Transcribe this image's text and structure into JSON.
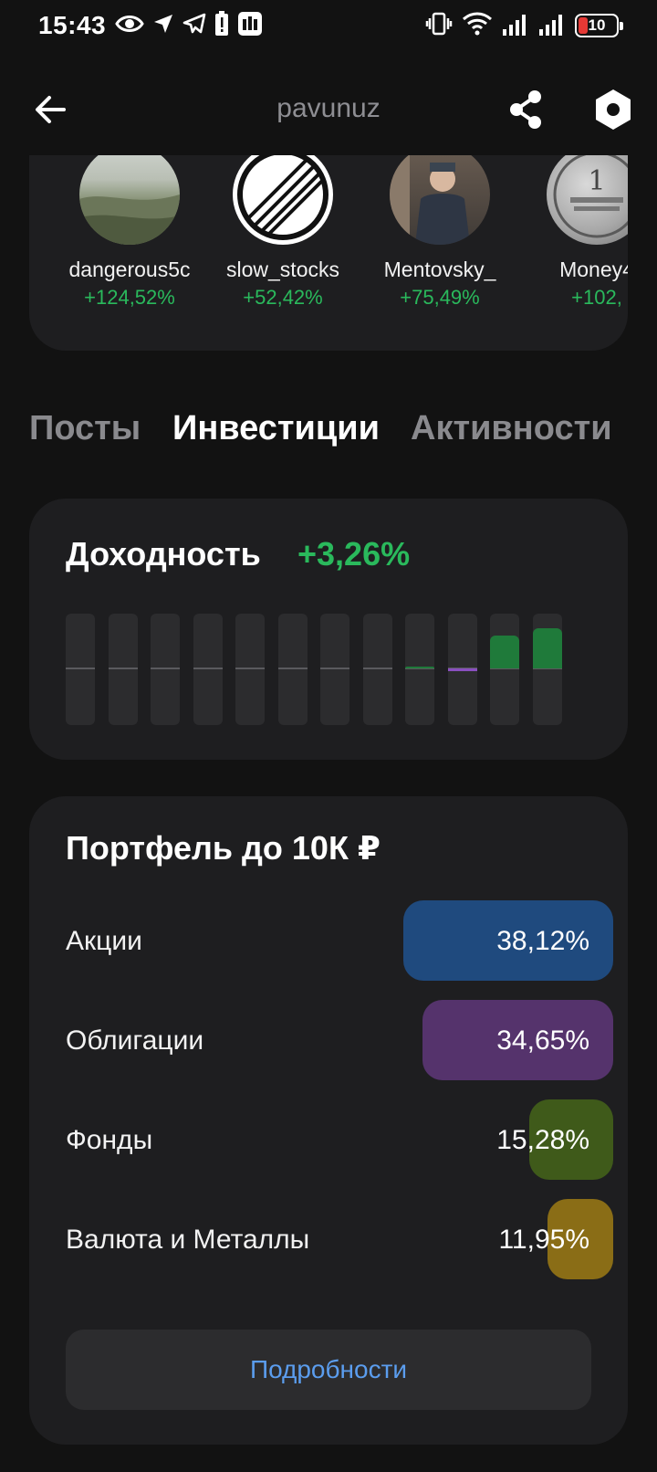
{
  "status_bar": {
    "time": "15:43",
    "battery": "10",
    "battery_color": "#e53935",
    "left_icons": [
      "eye-icon",
      "location-arrow-icon",
      "telegram-icon",
      "alert-battery-icon",
      "app-notification-icon"
    ],
    "right_icons": [
      "vibrate-icon",
      "wifi-icon",
      "signal-icon",
      "signal-icon-2",
      "battery-icon"
    ]
  },
  "app_bar": {
    "title": "pavunuz",
    "icons": [
      "back-arrow-icon",
      "share-icon",
      "hexagon-settings-icon"
    ]
  },
  "people": [
    {
      "name": "dangerous5с",
      "change": "+124,52%"
    },
    {
      "name": "slow_stocks",
      "change": "+52,42%"
    },
    {
      "name": "Mentovsky_",
      "change": "+75,49%"
    },
    {
      "name": "Money4",
      "change": "+102,"
    }
  ],
  "tabs": [
    {
      "label": "Посты",
      "active": false
    },
    {
      "label": "Инвестиции",
      "active": true
    },
    {
      "label": "Активности",
      "active": false
    }
  ],
  "yield": {
    "title": "Доходность",
    "value": "+3,26%",
    "value_color": "#2ab95c",
    "monthly_bars": [
      0,
      0,
      0,
      0,
      0,
      0,
      0,
      0,
      0.3,
      -0.8,
      9,
      11
    ],
    "bar_scale_max": 12
  },
  "portfolio": {
    "title": "Портфель до 10К ₽",
    "rows": [
      {
        "label": "Акции",
        "value": "38,12%",
        "share": 38.12,
        "color": "#1f4a7e"
      },
      {
        "label": "Облигации",
        "value": "34,65%",
        "share": 34.65,
        "color": "#55336c"
      },
      {
        "label": "Фонды",
        "value": "15,28%",
        "share": 15.28,
        "color": "#3f5a1a"
      },
      {
        "label": "Валюта и Металлы",
        "value": "11,95%",
        "share": 11.95,
        "color": "#8a6d16"
      }
    ],
    "details_button": "Подробности"
  }
}
